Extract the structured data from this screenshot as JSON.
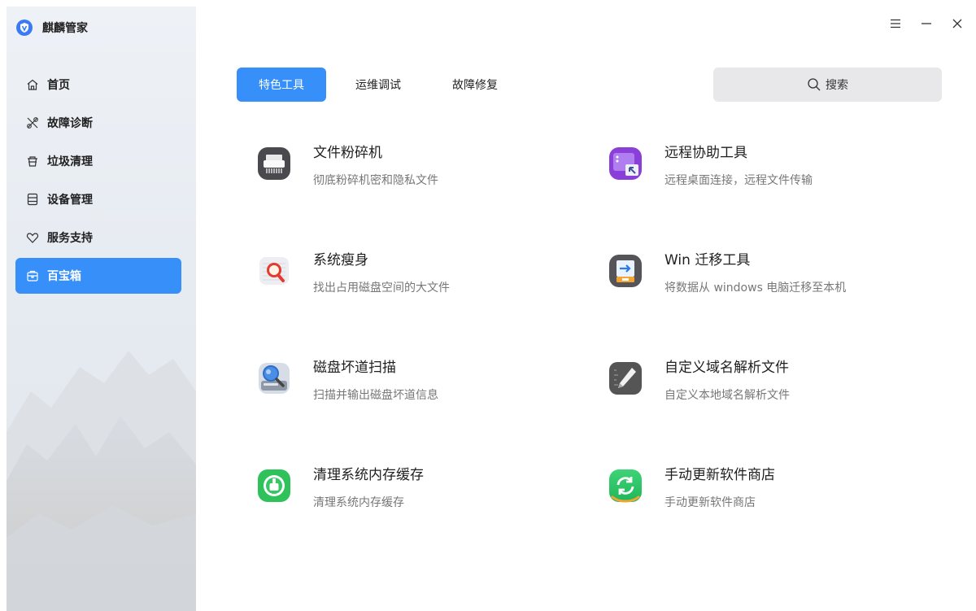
{
  "app": {
    "title": "麒麟管家"
  },
  "sidebar": {
    "items": [
      {
        "label": "首页",
        "icon": "home-icon"
      },
      {
        "label": "故障诊断",
        "icon": "tools-icon"
      },
      {
        "label": "垃圾清理",
        "icon": "trash-icon"
      },
      {
        "label": "设备管理",
        "icon": "device-icon"
      },
      {
        "label": "服务支持",
        "icon": "heart-icon"
      },
      {
        "label": "百宝箱",
        "icon": "toolbox-icon",
        "active": true
      }
    ]
  },
  "tabs": [
    {
      "label": "特色工具",
      "active": true
    },
    {
      "label": "运维调试"
    },
    {
      "label": "故障修复"
    }
  ],
  "search": {
    "placeholder": "搜索"
  },
  "tools": [
    {
      "name": "文件粉碎机",
      "desc": "彻底粉碎机密和隐私文件",
      "icon": "shredder-icon"
    },
    {
      "name": "远程协助工具",
      "desc": "远程桌面连接，远程文件传输",
      "icon": "remote-assist-icon"
    },
    {
      "name": "系统瘦身",
      "desc": "找出占用磁盘空间的大文件",
      "icon": "magnifier-icon"
    },
    {
      "name": "Win 迁移工具",
      "desc": "将数据从 windows 电脑迁移至本机",
      "icon": "win-migrate-icon"
    },
    {
      "name": "磁盘坏道扫描",
      "desc": "扫描并输出磁盘坏道信息",
      "icon": "disk-scan-icon"
    },
    {
      "name": "自定义域名解析文件",
      "desc": "自定义本地域名解析文件",
      "icon": "hosts-edit-icon"
    },
    {
      "name": "清理系统内存缓存",
      "desc": "清理系统内存缓存",
      "icon": "memory-clean-icon"
    },
    {
      "name": "手动更新软件商店",
      "desc": "手动更新软件商店",
      "icon": "store-update-icon"
    }
  ],
  "colors": {
    "accent": "#3790fa",
    "sidebar_bg": "#eef1f6",
    "search_bg": "#e8e8ea"
  }
}
